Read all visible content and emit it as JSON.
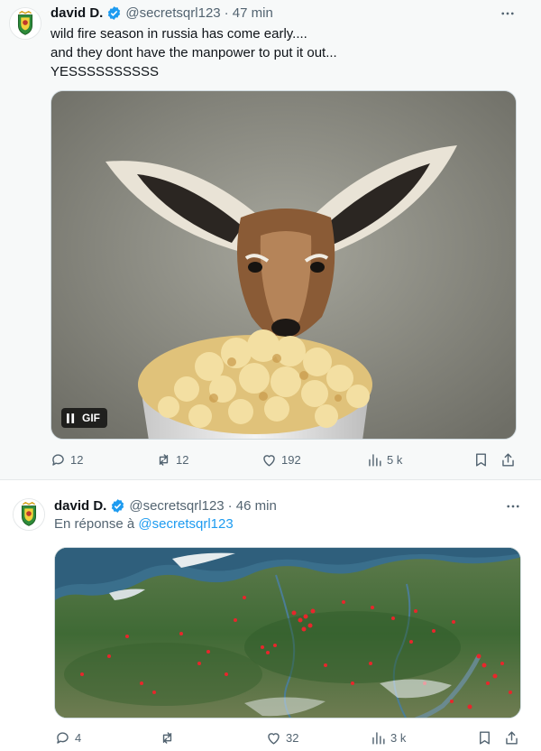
{
  "tweets": [
    {
      "author_name": "david D.",
      "handle": "@secretsqrl123",
      "time": "· 47 min",
      "text": "wild fire season in russia has come early....\nand they dont have the manpower to put it out...\nYESSSSSSSSSS",
      "media_badge": "GIF",
      "actions": {
        "replies": "12",
        "reposts": "12",
        "likes": "192",
        "views": "5 k"
      }
    },
    {
      "author_name": "david D.",
      "handle": "@secretsqrl123",
      "time": "· 46 min",
      "reply_prefix": "En réponse à",
      "reply_to": "@secretsqrl123",
      "actions": {
        "replies": "4",
        "reposts": "",
        "likes": "32",
        "views": "3 k"
      }
    }
  ],
  "colors": {
    "verified": "#1d9bf0",
    "muted": "#536471",
    "link": "#1d9bf0",
    "fire": "#e8262b"
  },
  "icons": [
    "reply-icon",
    "repost-icon",
    "like-icon",
    "views-icon",
    "bookmark-icon",
    "share-icon",
    "more-icon",
    "pause-icon",
    "verified-badge-icon"
  ]
}
